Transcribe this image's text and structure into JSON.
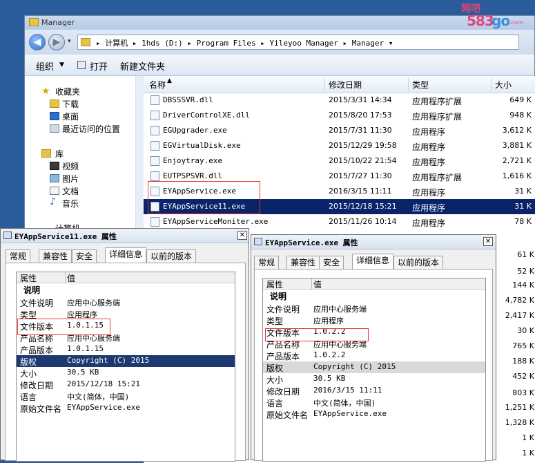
{
  "watermark": {
    "top": "网吧",
    "num_a": "583",
    "num_b": "go",
    "url": ".com"
  },
  "explorer": {
    "title": "Manager",
    "address": "▸ 计算机 ▸ 1hds (D:) ▸ Program Files ▸ Yileyoo Manager ▸ Manager ▾",
    "toolbar": {
      "organize": "组织",
      "open": "打开",
      "new_folder": "新建文件夹"
    },
    "nav": {
      "favorites": "收藏夹",
      "downloads": "下载",
      "desktop": "桌面",
      "recent": "最近访问的位置",
      "libraries": "库",
      "videos": "视频",
      "pictures": "图片",
      "documents": "文档",
      "music": "音乐",
      "computer": "计算机"
    },
    "columns": {
      "name": "名称",
      "date": "修改日期",
      "type": "类型",
      "size": "大小"
    },
    "files": [
      {
        "name": "DBSSSVR.dll",
        "date": "2015/3/31 14:34",
        "type": "应用程序扩展",
        "size": "649 K"
      },
      {
        "name": "DriverControlXE.dll",
        "date": "2015/8/20 17:53",
        "type": "应用程序扩展",
        "size": "948 K"
      },
      {
        "name": "EGUpgrader.exe",
        "date": "2015/7/31 11:30",
        "type": "应用程序",
        "size": "3,612 K"
      },
      {
        "name": "EGVirtualDisk.exe",
        "date": "2015/12/29 19:58",
        "type": "应用程序",
        "size": "3,881 K"
      },
      {
        "name": "Enjoytray.exe",
        "date": "2015/10/22 21:54",
        "type": "应用程序",
        "size": "2,721 K"
      },
      {
        "name": "EUTPSPSVR.dll",
        "date": "2015/7/27 11:30",
        "type": "应用程序扩展",
        "size": "1,616 K"
      },
      {
        "name": "EYAppService.exe",
        "date": "2016/3/15 11:11",
        "type": "应用程序",
        "size": "31 K"
      },
      {
        "name": "EYAppService11.exe",
        "date": "2015/12/18 15:21",
        "type": "应用程序",
        "size": "31 K"
      },
      {
        "name": "EYAppServiceMoniter.exe",
        "date": "2015/11/26 10:14",
        "type": "应用程序",
        "size": "78 K"
      }
    ],
    "extra_sizes": [
      "61 K",
      "52 K",
      "144 K",
      "4,782 K",
      "2,417 K",
      "30 K",
      "765 K",
      "188 K",
      "452 K",
      "803 K",
      "1,251 K",
      "1,328 K",
      "1 K",
      "1 K"
    ]
  },
  "dialog_left": {
    "title": "EYAppService11.exe 属性",
    "tabs": [
      "常规",
      "兼容性",
      "安全",
      "详细信息",
      "以前的版本"
    ],
    "head_prop": "属性",
    "head_val": "值",
    "group": "说明",
    "rows": [
      {
        "k": "文件说明",
        "v": "应用中心服务端"
      },
      {
        "k": "类型",
        "v": "应用程序"
      },
      {
        "k": "文件版本",
        "v": "1.0.1.15"
      },
      {
        "k": "产品名称",
        "v": "应用中心服务端"
      },
      {
        "k": "产品版本",
        "v": "1.0.1.15"
      },
      {
        "k": "版权",
        "v": "Copyright (C) 2015"
      },
      {
        "k": "大小",
        "v": "30.5 KB"
      },
      {
        "k": "修改日期",
        "v": "2015/12/18 15:21"
      },
      {
        "k": "语言",
        "v": "中文(简体，中国)"
      },
      {
        "k": "原始文件名",
        "v": "EYAppService.exe"
      }
    ]
  },
  "dialog_right": {
    "title": "EYAppService.exe 属性",
    "tabs": [
      "常规",
      "兼容性",
      "安全",
      "详细信息",
      "以前的版本"
    ],
    "head_prop": "属性",
    "head_val": "值",
    "group": "说明",
    "rows": [
      {
        "k": "文件说明",
        "v": "应用中心服务端"
      },
      {
        "k": "类型",
        "v": "应用程序"
      },
      {
        "k": "文件版本",
        "v": "1.0.2.2"
      },
      {
        "k": "产品名称",
        "v": "应用中心服务端"
      },
      {
        "k": "产品版本",
        "v": "1.0.2.2"
      },
      {
        "k": "版权",
        "v": "Copyright (C) 2015"
      },
      {
        "k": "大小",
        "v": "30.5 KB"
      },
      {
        "k": "修改日期",
        "v": "2016/3/15 11:11"
      },
      {
        "k": "语言",
        "v": "中文(简体，中国)"
      },
      {
        "k": "原始文件名",
        "v": "EYAppService.exe"
      }
    ]
  }
}
